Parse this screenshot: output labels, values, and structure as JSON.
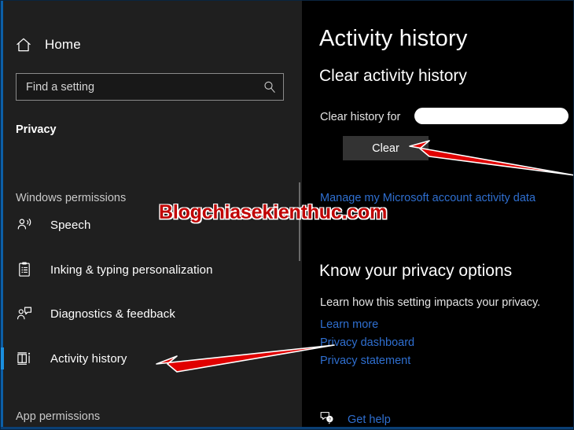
{
  "sidebar": {
    "home": {
      "label": "Home",
      "icon": "home-icon"
    },
    "search": {
      "placeholder": "Find a setting",
      "value": "",
      "icon": "search-icon"
    },
    "category": "Privacy",
    "groups": [
      {
        "title": "Windows permissions"
      },
      {
        "title": "App permissions"
      }
    ],
    "items": [
      {
        "label": "Speech",
        "icon": "speech-person-icon",
        "selected": false
      },
      {
        "label": "Inking & typing personalization",
        "icon": "clipboard-icon",
        "selected": false
      },
      {
        "label": "Diagnostics & feedback",
        "icon": "person-feedback-icon",
        "selected": false
      },
      {
        "label": "Activity history",
        "icon": "activity-history-icon",
        "selected": true
      }
    ]
  },
  "main": {
    "title": "Activity history",
    "clear_section": {
      "heading": "Clear activity history",
      "description": "Clear history for",
      "button_label": "Clear",
      "manage_link": "Manage my Microsoft account activity data"
    },
    "privacy_section": {
      "heading": "Know your privacy options",
      "description": "Learn how this setting impacts your privacy.",
      "links": [
        "Learn more",
        "Privacy dashboard",
        "Privacy statement"
      ]
    },
    "get_help": {
      "label": "Get help",
      "icon": "help-chat-icon"
    }
  },
  "annotations": {
    "watermark": "Blogchiasekienthuc.com",
    "arrow_color": "#e00000",
    "redaction_color": "#ffffff"
  },
  "colors": {
    "sidebar_bg": "#1f1f1f",
    "main_bg": "#000000",
    "accent": "#1a8fe0",
    "link": "#2f6fd0",
    "button_bg": "#333333"
  }
}
